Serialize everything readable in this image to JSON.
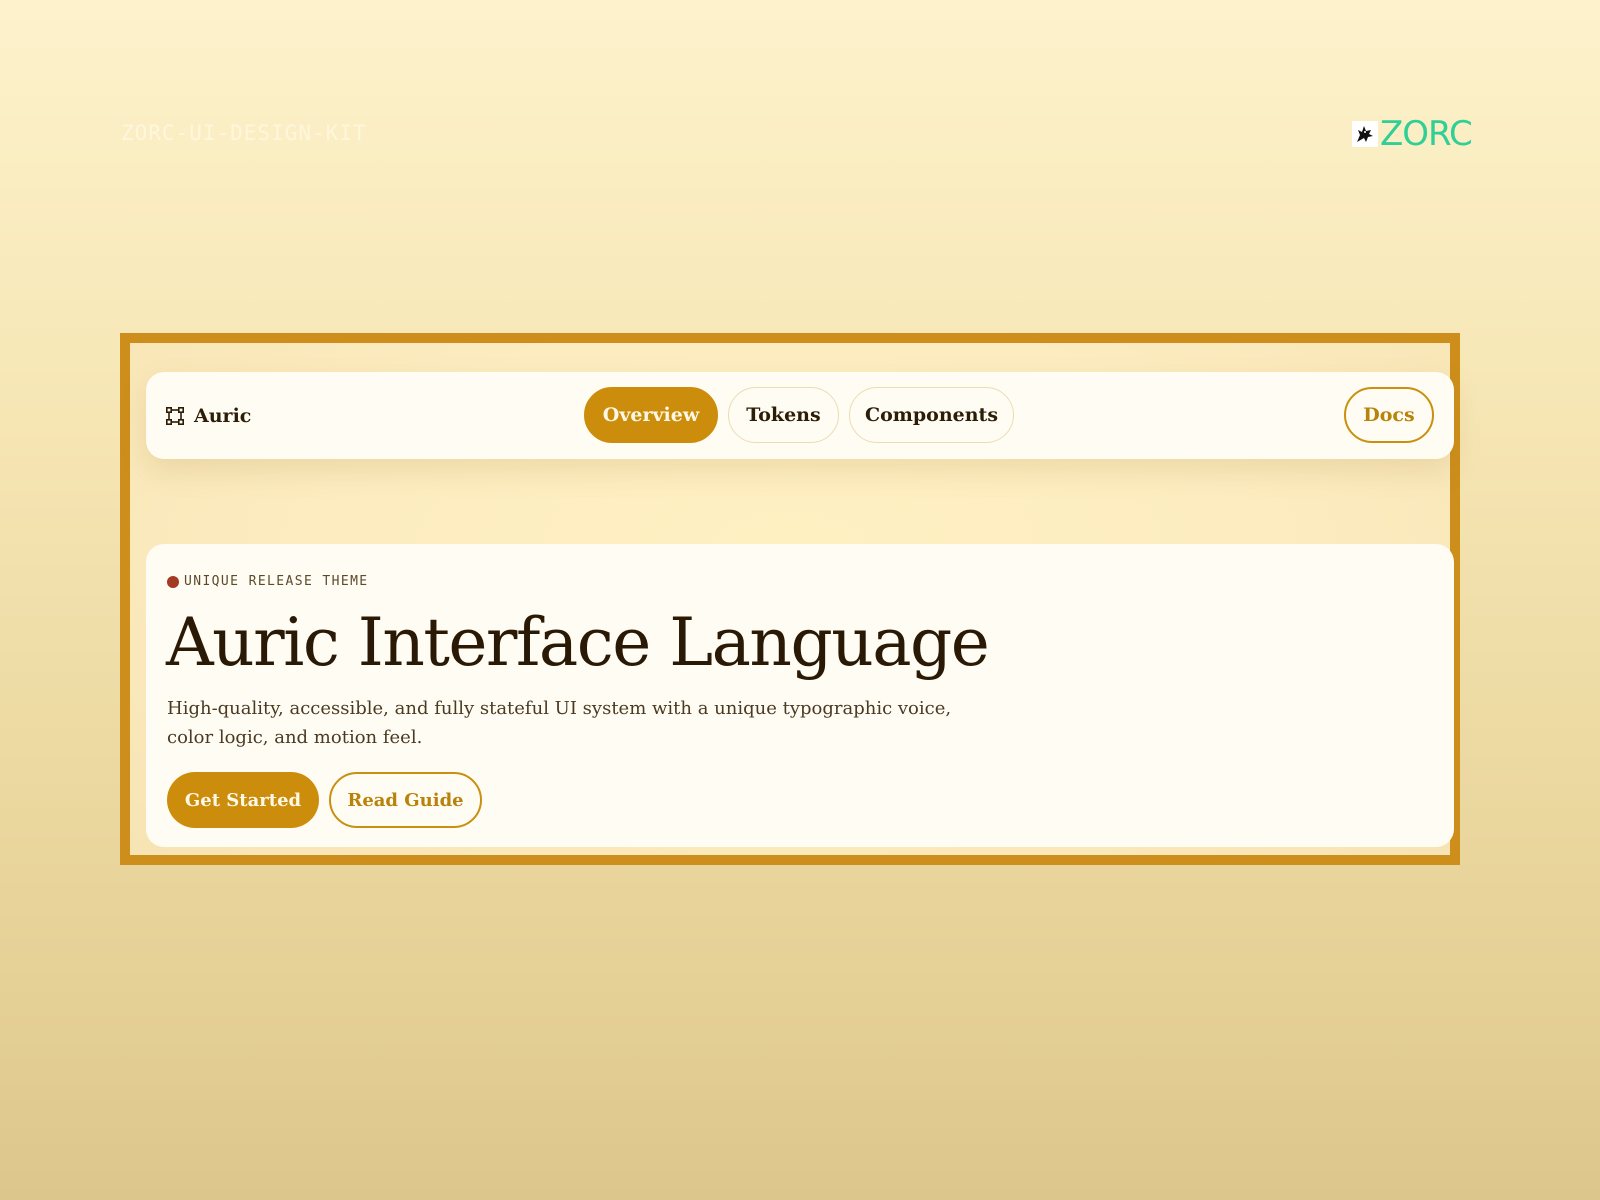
{
  "header": {
    "kit_label": "ZORC-UI-DESIGN-KIT",
    "logo_text": "ZORC",
    "logo_icon": "wolf-icon",
    "logo_color": "#2fcf95"
  },
  "nav": {
    "brand_name": "Auric",
    "brand_icon": "vector-nodes-icon",
    "tabs": [
      {
        "label": "Overview",
        "active": true
      },
      {
        "label": "Tokens",
        "active": false
      },
      {
        "label": "Components",
        "active": false
      }
    ],
    "docs_label": "Docs"
  },
  "hero": {
    "eyebrow": "UNIQUE RELEASE THEME",
    "title": "Auric Interface Language",
    "description": "High-quality, accessible, and fully stateful UI system with a unique typographic voice, color logic, and motion feel.",
    "primary_action": "Get Started",
    "secondary_action": "Read Guide"
  },
  "colors": {
    "accent": "#cd8d0c",
    "frame": "#cd8e1b",
    "ink": "#2a1a05",
    "status_dot": "#a23a24",
    "card": "#fffcf4"
  }
}
